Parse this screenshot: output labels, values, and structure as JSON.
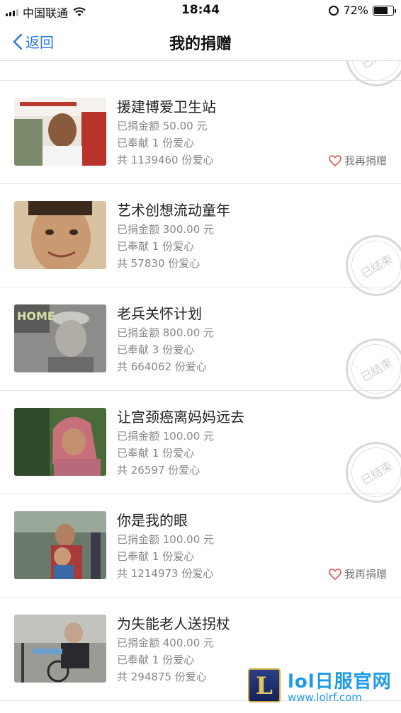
{
  "status_bar": {
    "carrier": "中国联通",
    "time": "18:44",
    "battery": "72%",
    "battery_level": 0.72
  },
  "nav": {
    "back_label": "返回",
    "title": "我的捐赠"
  },
  "partial_item": {
    "stamp": "已结束"
  },
  "items": [
    {
      "title": "援建博爱卫生站",
      "amount": "已捐金额 50.00 元",
      "times": "已奉献 1 份爱心",
      "total": "共 1139460 份爱心",
      "again": "我再捐赠"
    },
    {
      "title": "艺术创想流动童年",
      "amount": "已捐金额 300.00 元",
      "times": "已奉献 1 份爱心",
      "total": "共 57830 份爱心",
      "stamp": "已结束"
    },
    {
      "title": "老兵关怀计划",
      "amount": "已捐金额 800.00 元",
      "times": "已奉献 3 份爱心",
      "total": "共 664062 份爱心",
      "stamp": "已结束"
    },
    {
      "title": "让宫颈癌离妈妈远去",
      "amount": "已捐金额 100.00 元",
      "times": "已奉献 1 份爱心",
      "total": "共 26597 份爱心",
      "stamp": "已结束"
    },
    {
      "title": "你是我的眼",
      "amount": "已捐金额 100.00 元",
      "times": "已奉献 1 份爱心",
      "total": "共 1214973 份爱心",
      "again": "我再捐赠"
    },
    {
      "title": "为失能老人送拐杖",
      "amount": "已捐金额 400.00 元",
      "times": "已奉献 1 份爱心",
      "total": "共 294875 份爱心"
    }
  ],
  "watermark": {
    "title": "lol日服官网",
    "url": "www.lolrf.com",
    "logo_letter": "L"
  }
}
